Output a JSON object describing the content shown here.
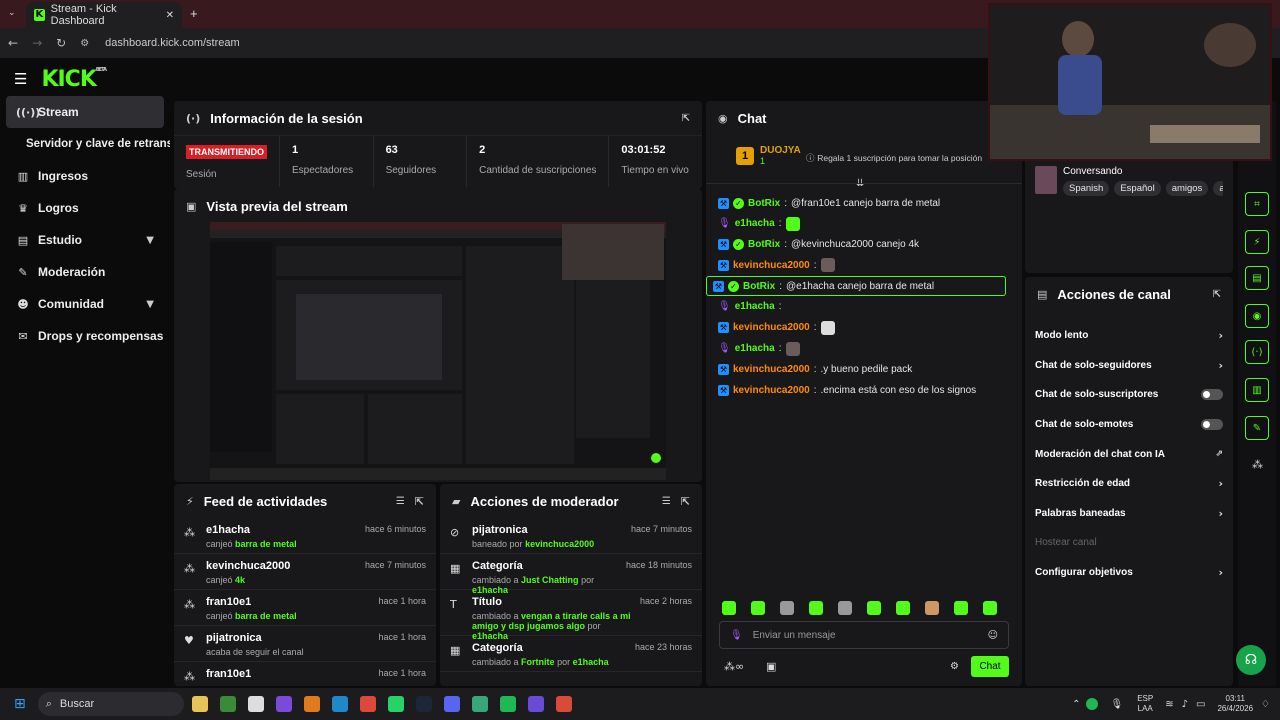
{
  "browser": {
    "tab_title": "Stream - Kick Dashboard",
    "url": "dashboard.kick.com/stream"
  },
  "brand": {
    "logo": "KICK",
    "beta": "BETA",
    "accent": "#53fc18"
  },
  "sidebar": {
    "items": [
      {
        "label": "Stream",
        "icon": "broadcast-icon",
        "active": true
      },
      {
        "label": "Servidor y clave de retransn"
      },
      {
        "label": "Ingresos",
        "icon": "chart-icon"
      },
      {
        "label": "Logros",
        "icon": "trophy-icon"
      },
      {
        "label": "Estudio",
        "icon": "studio-icon",
        "expandable": true
      },
      {
        "label": "Moderación",
        "icon": "wrench-icon"
      },
      {
        "label": "Comunidad",
        "icon": "community-icon",
        "expandable": true
      },
      {
        "label": "Drops y recompensas",
        "icon": "gift-icon"
      }
    ]
  },
  "session": {
    "title": "Información de la sesión",
    "live_label": "TRANSMITIENDO",
    "session_label": "Sesión",
    "stats": [
      {
        "value": "1",
        "label": "Espectadores"
      },
      {
        "value": "63",
        "label": "Seguidores"
      },
      {
        "value": "2",
        "label": "Cantidad de suscripciones"
      },
      {
        "value": "03:01:52",
        "label": "Tiempo en vivo"
      }
    ]
  },
  "preview": {
    "title": "Vista previa del stream"
  },
  "feed": {
    "title": "Feed de actividades",
    "items": [
      {
        "name": "e1hacha",
        "prefix": "canjeó",
        "highlight": "barra de metal",
        "time": "hace 6 minutos"
      },
      {
        "name": "kevinchuca2000",
        "prefix": "canjeó",
        "highlight": "4k",
        "time": "hace 7 minutos"
      },
      {
        "name": "fran10e1",
        "prefix": "canjeó",
        "highlight": "barra de metal",
        "time": "hace 1 hora"
      },
      {
        "name": "pijatronica",
        "prefix": "acaba de seguir el canal",
        "highlight": "",
        "time": "hace 1 hora"
      },
      {
        "name": "fran10e1",
        "prefix": "",
        "highlight": "",
        "time": "hace 1 hora"
      }
    ]
  },
  "modactions": {
    "title": "Acciones de moderador",
    "items": [
      {
        "name": "pijatronica",
        "prefix": "baneado por",
        "highlight": "kevinchuca2000",
        "time": "hace 7 minutos"
      },
      {
        "name": "Categoría",
        "prefix": "cambiado a",
        "highlight": "Just Chatting",
        "by": "por",
        "who": "e1hacha",
        "time": "hace 18 minutos"
      },
      {
        "name": "Título",
        "prefix": "cambiado a",
        "highlight": "vengan a tirarle calls a mi amigo y dsp jugamos algo",
        "by": "por",
        "who": "e1hacha",
        "time": "hace 2 horas"
      },
      {
        "name": "Categoría",
        "prefix": "cambiado a",
        "highlight": "Fortnite",
        "by": "por",
        "who": "e1hacha",
        "time": "hace 23 horas"
      }
    ]
  },
  "chat": {
    "title": "Chat",
    "top_gifter": "DUOJYA",
    "top_rank": "1",
    "top_count": "1",
    "gift_cta": "Regala 1 suscripción para tomar la posición",
    "messages": [
      {
        "user": "BotRix",
        "color": "#53fc18",
        "text": "@fran10e1 canejo barra de metal"
      },
      {
        "user": "e1hacha",
        "color": "#53fc18",
        "text": ""
      },
      {
        "user": "BotRix",
        "color": "#53fc18",
        "text": "@kevinchuca2000 canejo 4k"
      },
      {
        "user": "kevinchuca2000",
        "color": "#ff8c00",
        "text": ""
      },
      {
        "user": "BotRix",
        "color": "#53fc18",
        "text": "@e1hacha canejo barra de metal"
      },
      {
        "user": "e1hacha",
        "color": "#53fc18",
        "text": ""
      },
      {
        "user": "kevinchuca2000",
        "color": "#ff8c00",
        "text": ""
      },
      {
        "user": "e1hacha",
        "color": "#53fc18",
        "text": ""
      },
      {
        "user": "kevinchuca2000",
        "color": "#ff8c00",
        "text": ".y bueno pedile pack"
      },
      {
        "user": "kevinchuca2000",
        "color": "#ff8c00",
        "text": ".encima está con eso de los signos"
      }
    ],
    "input_placeholder": "Enviar un mensaje",
    "send_label": "Chat"
  },
  "stream_info": {
    "category": "Conversando",
    "tags": [
      "Spanish",
      "Español",
      "amigos",
      "a"
    ]
  },
  "channel_actions": {
    "title": "Acciones de canal",
    "items": [
      {
        "label": "Modo lento",
        "kind": "arrow"
      },
      {
        "label": "Chat de solo-seguidores",
        "kind": "arrow"
      },
      {
        "label": "Chat de solo-suscriptores",
        "kind": "toggle"
      },
      {
        "label": "Chat de solo-emotes",
        "kind": "toggle"
      },
      {
        "label": "Moderación del chat con IA",
        "kind": "external"
      },
      {
        "label": "Restricción de edad",
        "kind": "arrow"
      },
      {
        "label": "Palabras baneadas",
        "kind": "arrow"
      },
      {
        "label": "Hostear canal",
        "kind": "disabled"
      },
      {
        "label": "Configurar objetivos",
        "kind": "arrow"
      }
    ]
  },
  "taskbar": {
    "search": "Buscar",
    "lang": "ESP",
    "lang2": "LAA",
    "time": "03:11",
    "date": "26/4/2026"
  }
}
